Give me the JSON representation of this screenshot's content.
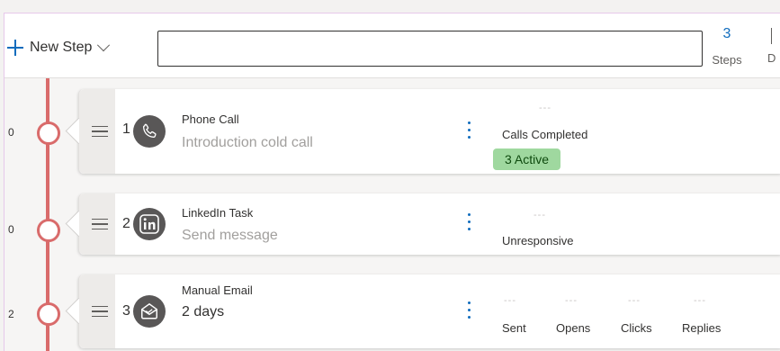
{
  "toolbar": {
    "new_step_label": "New Step",
    "search_value": "",
    "stats": [
      {
        "value": "3",
        "label": "Steps"
      },
      {
        "value": "",
        "label": "D"
      }
    ]
  },
  "colors": {
    "accent": "#0f6cbd",
    "timeline": "#d96b6b",
    "active_badge": "#9fd89f"
  },
  "steps": [
    {
      "left_count": "0",
      "number": "1",
      "icon": "phone-icon",
      "title": "Phone Call",
      "subtitle": "Introduction cold call",
      "metrics": [
        {
          "value": "---",
          "label": "Calls Completed"
        }
      ],
      "badge": "3 Active"
    },
    {
      "left_count": "0",
      "number": "2",
      "icon": "linkedin-icon",
      "title": "LinkedIn Task",
      "subtitle": "Send message",
      "metrics": [
        {
          "value": "---",
          "label": "Unresponsive"
        }
      ]
    },
    {
      "left_count": "2",
      "number": "3",
      "icon": "email-icon",
      "title": "Manual Email",
      "subtitle": "2 days",
      "metrics": [
        {
          "value": "---",
          "label": "Sent"
        },
        {
          "value": "---",
          "label": "Opens"
        },
        {
          "value": "---",
          "label": "Clicks"
        },
        {
          "value": "---",
          "label": "Replies"
        }
      ]
    }
  ]
}
